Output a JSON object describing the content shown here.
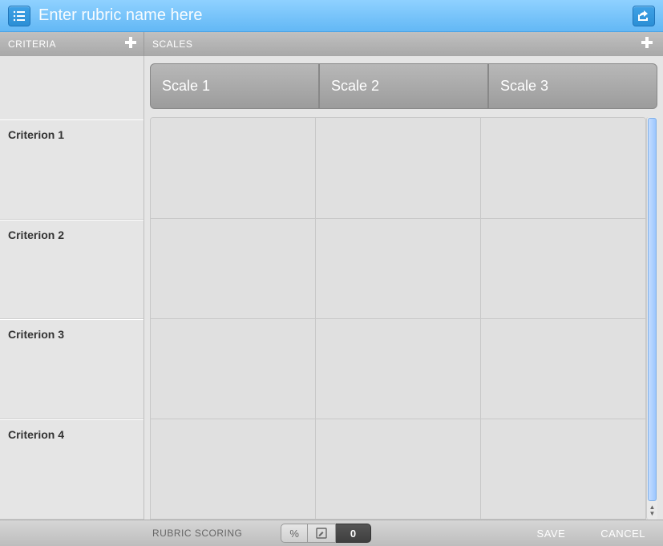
{
  "header": {
    "rubric_name_placeholder": "Enter rubric name here"
  },
  "subheader": {
    "criteria_label": "CRITERIA",
    "scales_label": "SCALES"
  },
  "criteria": [
    {
      "label": "Criterion 1"
    },
    {
      "label": "Criterion 2"
    },
    {
      "label": "Criterion 3"
    },
    {
      "label": "Criterion 4"
    }
  ],
  "scales": [
    {
      "label": "Scale 1"
    },
    {
      "label": "Scale 2"
    },
    {
      "label": "Scale 3"
    }
  ],
  "footer": {
    "scoring_label": "RUBRIC SCORING",
    "percent_label": "%",
    "count_value": "0",
    "save_label": "SAVE",
    "cancel_label": "CANCEL"
  }
}
